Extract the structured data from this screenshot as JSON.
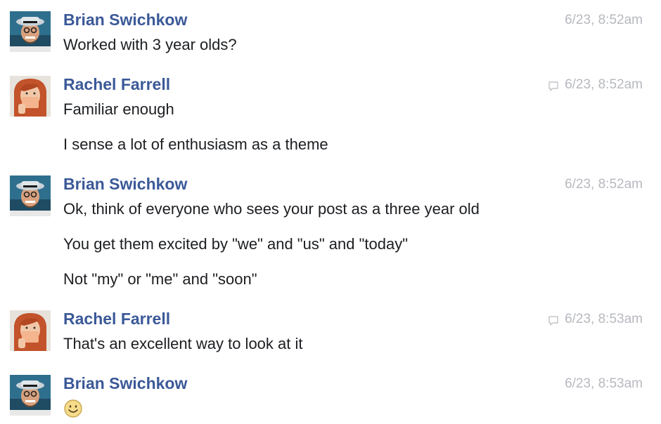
{
  "colors": {
    "sender_name": "#3b5998",
    "timestamp": "#b7b9bf",
    "message_text": "#1c1e21"
  },
  "messages": [
    {
      "sender": "Brian Swichkow",
      "timestamp": "6/23, 8:52am",
      "seen_indicator": false,
      "lines": [
        "Worked with 3 year olds?"
      ]
    },
    {
      "sender": "Rachel Farrell",
      "timestamp": "6/23, 8:52am",
      "seen_indicator": true,
      "lines": [
        "Familiar enough",
        "I sense a lot of enthusiasm as a theme"
      ]
    },
    {
      "sender": "Brian Swichkow",
      "timestamp": "6/23, 8:52am",
      "seen_indicator": false,
      "lines": [
        "Ok, think of everyone who sees your post as a three year old",
        "You get them excited by \"we\" and \"us\" and \"today\"",
        "Not \"my\" or \"me\" and \"soon\""
      ]
    },
    {
      "sender": "Rachel Farrell",
      "timestamp": "6/23, 8:53am",
      "seen_indicator": true,
      "lines": [
        "That's an excellent way to look at it"
      ]
    },
    {
      "sender": "Brian Swichkow",
      "timestamp": "6/23, 8:53am",
      "seen_indicator": false,
      "emoji": "smiley-emoji-icon",
      "lines": []
    }
  ]
}
